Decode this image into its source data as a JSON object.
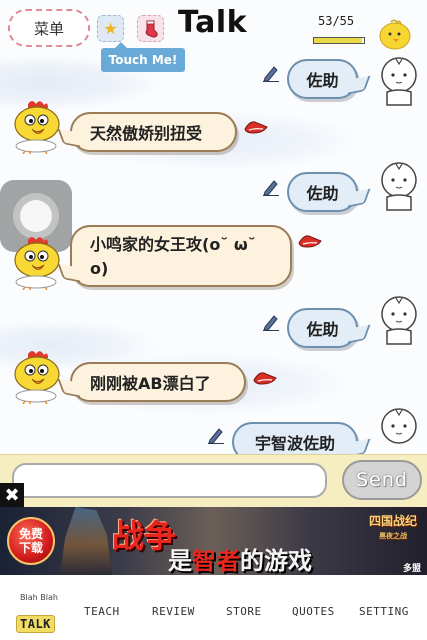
{
  "header": {
    "menu_label": "菜单",
    "title": "Talk",
    "touch_me": "Touch Me!",
    "counter": "53/55",
    "counter_fraction": 0.96
  },
  "messages": [
    {
      "side": "right",
      "text": "佐助"
    },
    {
      "side": "left",
      "text": "天然傲娇别扭受"
    },
    {
      "side": "right",
      "text": "佐助"
    },
    {
      "side": "left",
      "text": "小鸣家的女王攻(o˘ ω˘ o)"
    },
    {
      "side": "right",
      "text": "佐助"
    },
    {
      "side": "left",
      "text": "刚刚被AB漂白了"
    },
    {
      "side": "right",
      "text": "宇智波佐助"
    }
  ],
  "input": {
    "value": "",
    "placeholder": "",
    "send_label": "Send"
  },
  "ad": {
    "close_glyph": "✖",
    "free_download": "免费\n下载",
    "headline": "战争",
    "slogan_a": "是",
    "slogan_hl": "智者",
    "slogan_b": "的游戏",
    "logo": "四国战纪",
    "logo_sub": "黑夜之战",
    "brand": "多盟"
  },
  "tabs": {
    "blah": "Blah Blah",
    "items": [
      "TALK",
      "TEACH",
      "REVIEW",
      "STORE",
      "QUOTES",
      "SETTING"
    ],
    "active": "TALK"
  },
  "colors": {
    "right_bubble_fill": "#e2edf8",
    "right_bubble_border": "#6e8fae",
    "left_bubble_fill": "#fdf2dd",
    "left_bubble_border": "#9a7d57",
    "input_bar": "#f6edc1",
    "tab_active": "#f2dd63"
  },
  "icons": {
    "star": "star-icon",
    "sock": "christmas-stocking-icon",
    "edit": "pencil-icon",
    "reply_marker": "red-mitten-icon",
    "user_avatar": "doodle-boy-avatar",
    "bot_avatar": "chicken-avatar"
  }
}
